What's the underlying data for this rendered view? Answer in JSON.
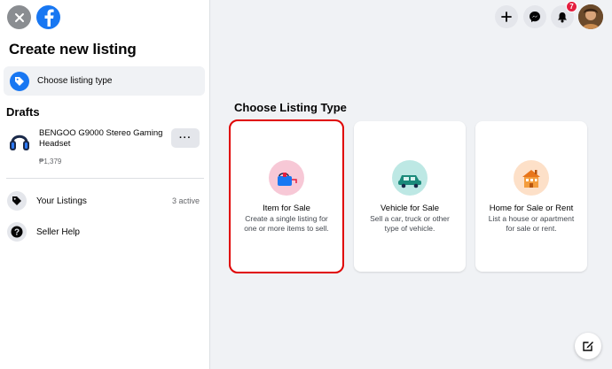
{
  "sidebar": {
    "title": "Create new listing",
    "choose_type_label": "Choose listing type",
    "drafts_title": "Drafts",
    "draft": {
      "name": "BENGOO G9000 Stereo Gaming Headset",
      "price": "₱1,379",
      "more_label": "···"
    },
    "your_listings": {
      "label": "Your Listings",
      "meta": "3 active"
    },
    "seller_help": {
      "label": "Seller Help"
    }
  },
  "header": {
    "notification_count": "7"
  },
  "main": {
    "title": "Choose Listing Type",
    "cards": [
      {
        "title": "Item for Sale",
        "desc": "Create a single listing for one or more items to sell."
      },
      {
        "title": "Vehicle for Sale",
        "desc": "Sell a car, truck or other type of vehicle."
      },
      {
        "title": "Home for Sale or Rent",
        "desc": "List a house or apartment for sale or rent."
      }
    ]
  },
  "icons": {
    "close": "close-icon",
    "logo": "facebook-logo-icon",
    "tag": "tag-icon",
    "help": "help-icon",
    "plus": "plus-icon",
    "messenger": "messenger-icon",
    "bell": "bell-icon",
    "compose": "compose-icon"
  },
  "colors": {
    "brand": "#1877f2",
    "selection": "#e00000",
    "badge": "#e41e3f"
  }
}
